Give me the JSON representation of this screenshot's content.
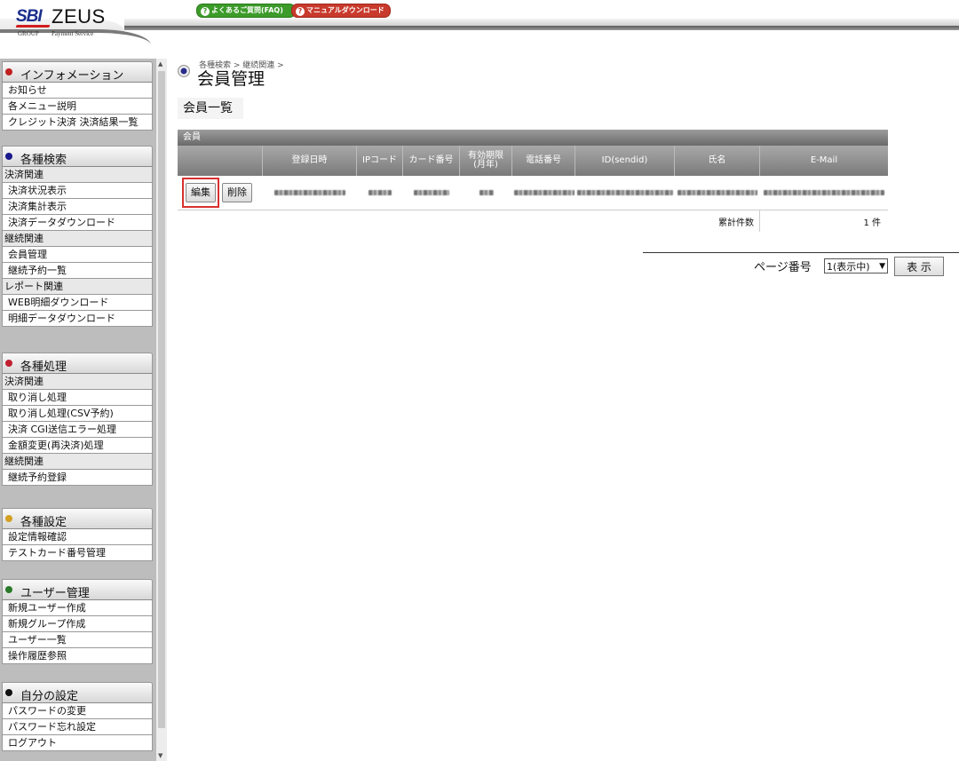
{
  "header": {
    "logo_sbi": "SBI",
    "logo_zeus": "ZEUS",
    "logo_group": "GROUP",
    "logo_sub": "Payment Service",
    "faq_label": "よくあるご質問(FAQ)",
    "manual_label": "マニュアルダウンロード"
  },
  "sidebar": {
    "info": {
      "title": "インフォメーション",
      "dot_color": "#c02020",
      "items": [
        "お知らせ",
        "各メニュー説明",
        "クレジット決済 決済結果一覧"
      ]
    },
    "search": {
      "title": "各種検索",
      "dot_color": "#1a1a8c",
      "cat1": "決済関連",
      "items1": [
        "決済状況表示",
        "決済集計表示",
        "決済データダウンロード"
      ],
      "cat2": "継続関連",
      "items2": [
        "会員管理",
        "継続予約一覧"
      ],
      "cat3": "レポート関連",
      "items3": [
        "WEB明細ダウンロード",
        "明細データダウンロード"
      ]
    },
    "process": {
      "title": "各種処理",
      "dot_color": "#c02030",
      "cat1": "決済関連",
      "items1": [
        "取り消し処理",
        "取り消し処理(CSV予約)",
        "決済 CGI送信エラー処理",
        "金額変更(再決済)処理"
      ],
      "cat2": "継続関連",
      "items2": [
        "継続予約登録"
      ]
    },
    "settings": {
      "title": "各種設定",
      "dot_color": "#d4a020",
      "items": [
        "設定情報確認",
        "テストカード番号管理"
      ]
    },
    "users": {
      "title": "ユーザー管理",
      "dot_color": "#2a7a2a",
      "items": [
        "新規ユーザー作成",
        "新規グループ作成",
        "ユーザー一覧",
        "操作履歴参照"
      ]
    },
    "self": {
      "title": "自分の設定",
      "dot_color": "#111111",
      "items": [
        "パスワードの変更",
        "パスワード忘れ設定",
        "ログアウト"
      ]
    }
  },
  "main": {
    "breadcrumb": "各種検索 > 継続関連 >",
    "page_title": "会員管理",
    "section_title": "会員一覧",
    "table_caption": "会員",
    "columns": [
      "登録日時",
      "IPコード",
      "カード番号",
      "有効期限\n(月年)",
      "電話番号",
      "ID(sendid)",
      "氏名",
      "E-Mail"
    ],
    "edit_label": "編集",
    "delete_label": "削除",
    "total_label": "累計件数",
    "total_value": "1 件"
  },
  "pager": {
    "label": "ページ番号",
    "selected": "1(表示中)",
    "button": "表 示"
  }
}
